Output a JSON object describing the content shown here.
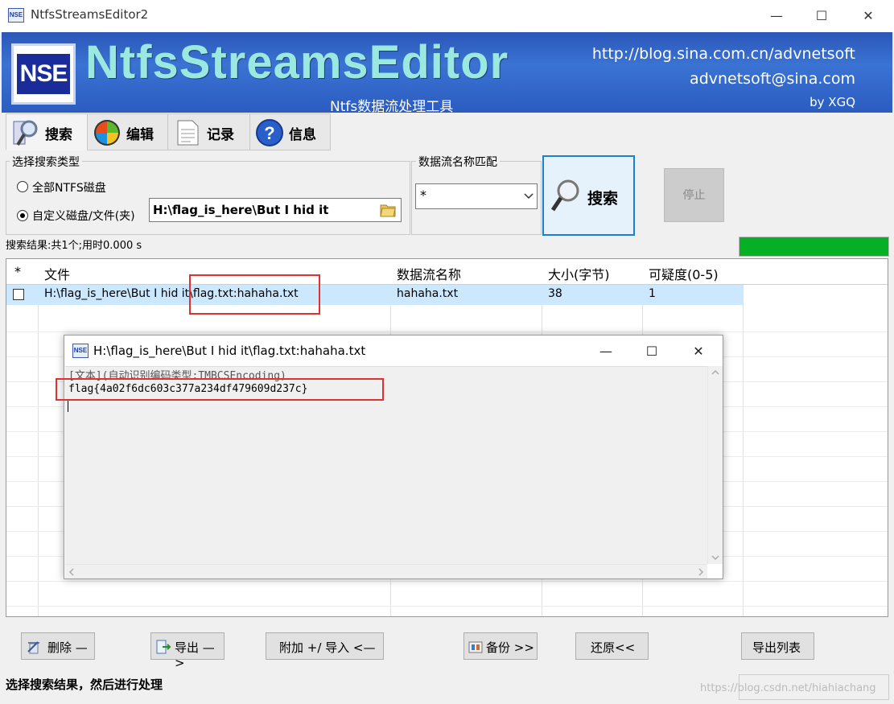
{
  "window": {
    "title": "NtfsStreamsEditor2",
    "minimize": "—",
    "maximize": "☐",
    "close": "✕"
  },
  "banner": {
    "logo_text": "NSE",
    "brand": "NtfsStreamsEditor",
    "subtitle": "Ntfs数据流处理工具",
    "url": "http://blog.sina.com.cn/advnetsoft",
    "email": "advnetsoft@sina.com",
    "author": "by XGQ",
    "colors": {
      "banner_bg": "#2e62c6",
      "brand_text": "#9be8e0"
    }
  },
  "tabs": [
    {
      "label": "搜索",
      "icon": "magnifier-icon",
      "active": true
    },
    {
      "label": "编辑",
      "icon": "windows-logo-icon",
      "active": false
    },
    {
      "label": "记录",
      "icon": "document-icon",
      "active": false
    },
    {
      "label": "信息",
      "icon": "help-question-icon",
      "active": false
    }
  ],
  "search": {
    "type_group_label": "选择搜索类型",
    "option_all": "全部NTFS磁盘",
    "option_custom": "自定义磁盘/文件(夹)",
    "selected_option": "option_custom",
    "path_value": "H:\\flag_is_here\\But I hid it",
    "name_match_label": "数据流名称匹配",
    "name_match_value": "*",
    "search_button": "搜索",
    "stop_button": "停止",
    "result_summary": "搜索结果:共1个;用时0.000 s",
    "progress_percent": 100
  },
  "grid": {
    "headers": [
      "*",
      "文件",
      "数据流名称",
      "大小(字节)",
      "可疑度(0-5)"
    ],
    "rows": [
      {
        "checked": false,
        "file": "H:\\flag_is_here\\But I hid it\\flag.txt:hahaha.txt",
        "stream": "hahaha.txt",
        "size": "38",
        "suspicion": "1"
      }
    ]
  },
  "popup": {
    "title": "H:\\flag_is_here\\But I hid it\\flag.txt:hahaha.txt",
    "line1": "[文本](自动识别编码类型:TMBCSEncoding)",
    "line2": "flag{4a02f6dc603c377a234df479609d237c}",
    "minimize": "—",
    "maximize": "☐",
    "close": "✕"
  },
  "buttons": {
    "delete": "删除 —",
    "export": "导出 —>",
    "attach": "附加 +/ 导入 <—",
    "backup": "备份 >>",
    "restore": "还原<<",
    "export_list": "导出列表"
  },
  "status": "选择搜索结果，然后进行处理",
  "watermark": "https://blog.csdn.net/hiahiachang",
  "highlight_color": "#e03030"
}
